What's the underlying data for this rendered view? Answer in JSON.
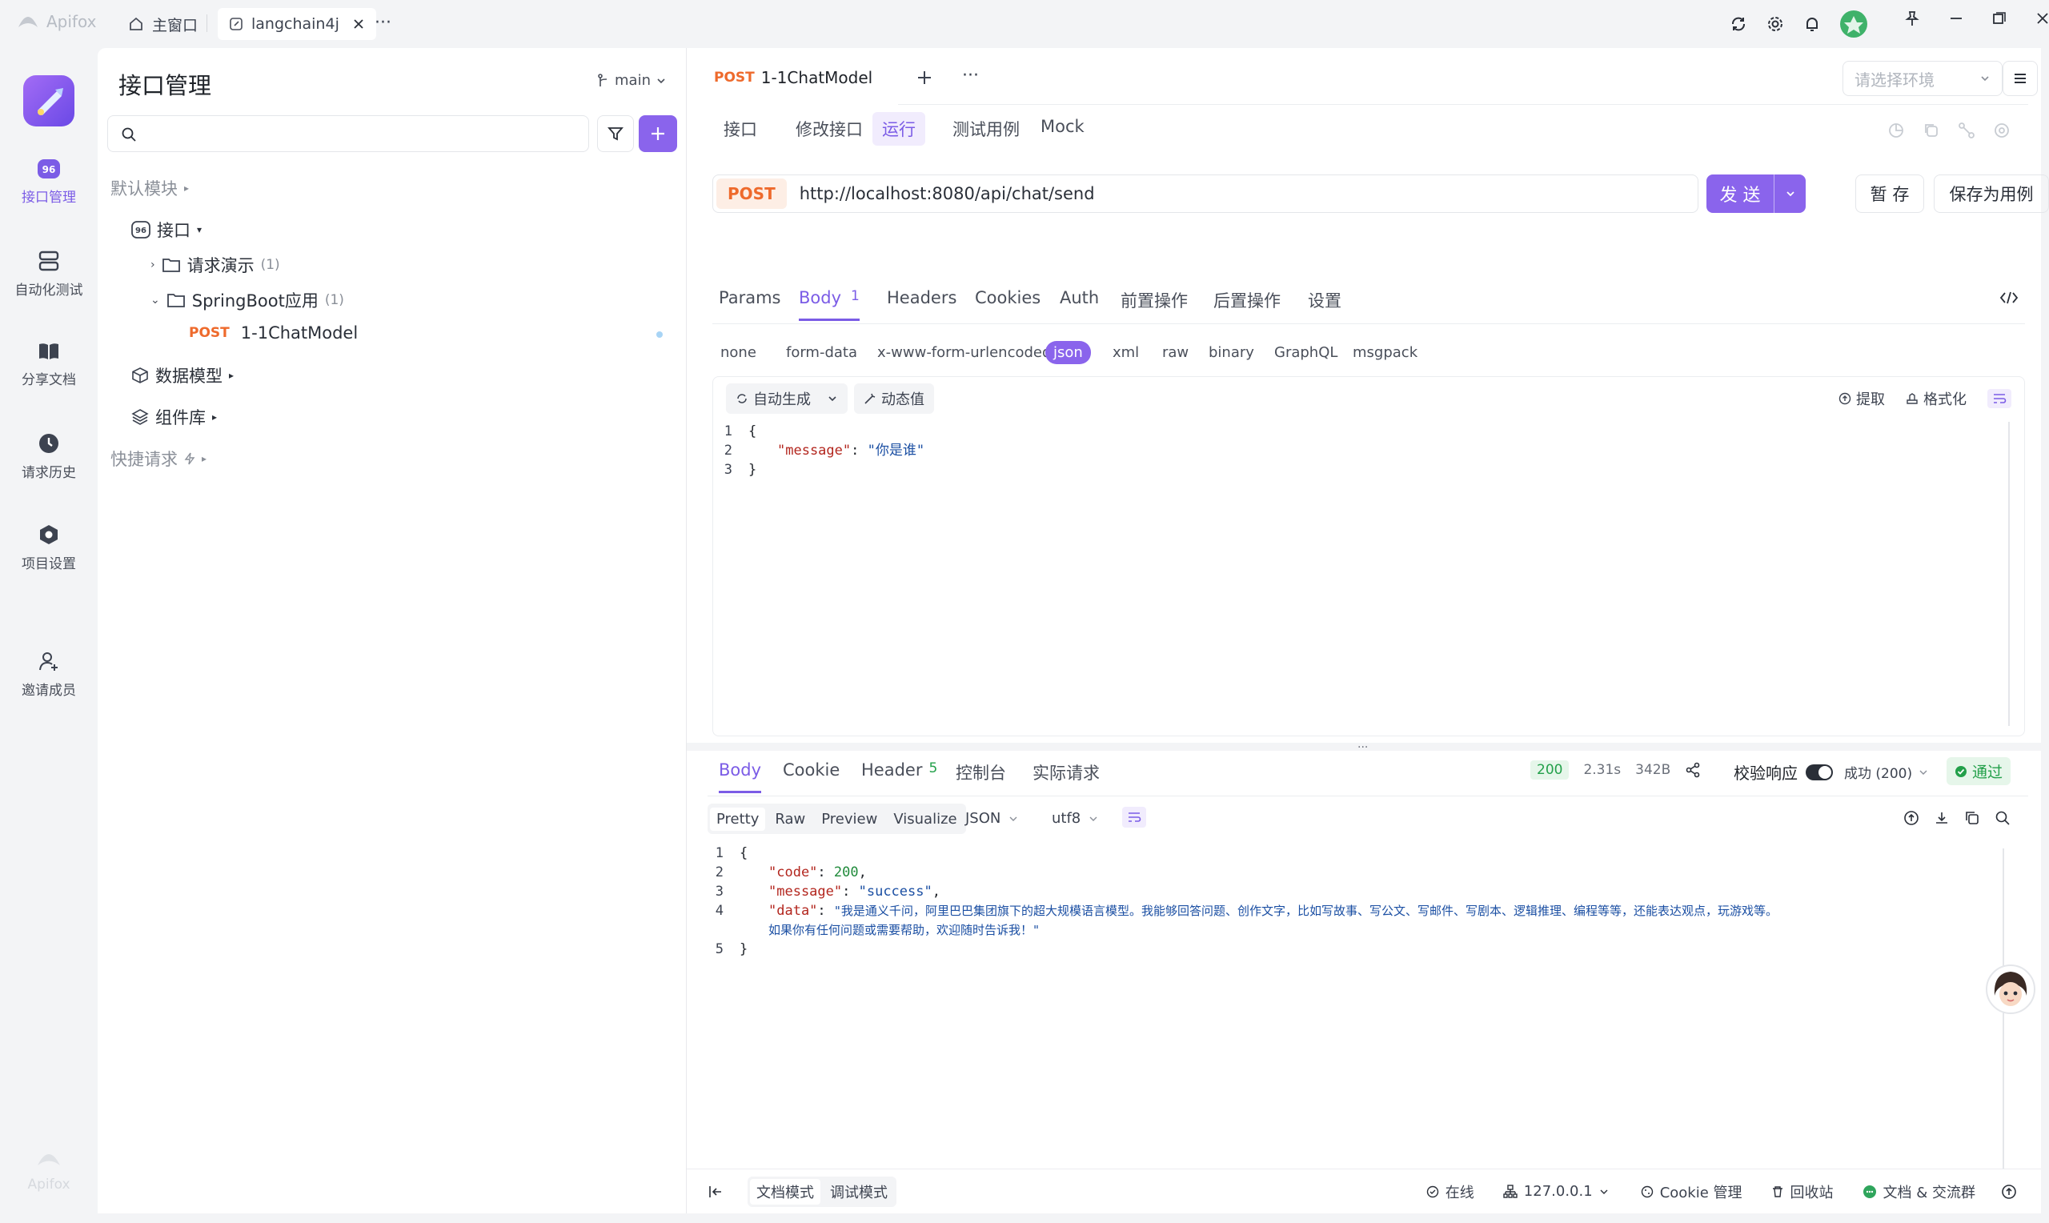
{
  "app": {
    "name": "Apifox"
  },
  "titlebar": {
    "tabs": [
      {
        "label": "主窗口",
        "icon": "home-icon"
      },
      {
        "label": "langchain4j",
        "icon": "link-icon"
      }
    ],
    "more": "···"
  },
  "rail": {
    "items": [
      {
        "label": "接口管理",
        "icon": "api-icon"
      },
      {
        "label": "自动化测试",
        "icon": "database-icon"
      },
      {
        "label": "分享文档",
        "icon": "book-icon"
      },
      {
        "label": "请求历史",
        "icon": "clock-icon"
      },
      {
        "label": "项目设置",
        "icon": "settings-icon"
      },
      {
        "label": "邀请成员",
        "icon": "add-user-icon"
      }
    ],
    "footer_logo": "Apifox"
  },
  "sidebar": {
    "title": "接口管理",
    "branch": "main",
    "search_placeholder": "",
    "tree": {
      "default_module": "默认模块",
      "api_root": "接口",
      "folder1": {
        "name": "请求演示",
        "count": "(1)"
      },
      "folder2": {
        "name": "SpringBoot应用",
        "count": "(1)"
      },
      "endpoint": {
        "method": "POST",
        "name": "1-1ChatModel"
      },
      "data_models": "数据模型",
      "components": "组件库",
      "quick_requests": "快捷请求"
    }
  },
  "main": {
    "tab": {
      "method": "POST",
      "name": "1-1ChatModel"
    },
    "env_placeholder": "请选择环境",
    "subtabs": [
      "接口",
      "修改接口",
      "运行",
      "测试用例",
      "Mock"
    ],
    "request": {
      "method": "POST",
      "url": "http://localhost:8080/api/chat/send",
      "send_label": "发 送",
      "save_label": "暂 存",
      "save_case_label": "保存为用例"
    },
    "param_tabs": [
      "Params",
      "Body",
      "Headers",
      "Cookies",
      "Auth",
      "前置操作",
      "后置操作",
      "设置"
    ],
    "body_count": "1",
    "body_types": [
      "none",
      "form-data",
      "x-www-form-urlencoded",
      "json",
      "xml",
      "raw",
      "binary",
      "GraphQL",
      "msgpack"
    ],
    "editor": {
      "auto_generate": "自动生成",
      "dynamic_value": "动态值",
      "extract": "提取",
      "format": "格式化",
      "lines": [
        {
          "n": "1",
          "open": "{"
        },
        {
          "n": "2",
          "key": "\"message\"",
          "value": "\"你是谁\""
        },
        {
          "n": "3",
          "close": "}"
        }
      ]
    },
    "response": {
      "tabs": [
        "Body",
        "Cookie",
        "Header",
        "控制台",
        "实际请求"
      ],
      "header_count": "5",
      "status": "200",
      "time": "2.31s",
      "size": "342B",
      "validate_label": "校验响应",
      "result": "成功 (200)",
      "pass_label": "通过",
      "views": [
        "Pretty",
        "Raw",
        "Preview",
        "Visualize"
      ],
      "format": "JSON",
      "encoding": "utf8",
      "lines": {
        "l1": "1",
        "l2": "2",
        "l3": "3",
        "l4": "4",
        "l5": "5",
        "code_key": "\"code\"",
        "code_val": "200",
        "message_key": "\"message\"",
        "message_val": "\"success\"",
        "data_key": "\"data\"",
        "data_val_1": "\"我是通义千问，阿里巴巴集团旗下的超大规模语言模型。我能够回答问题、创作文字，比如写故事、写公文、写邮件、写剧本、逻辑推理、编程等等，还能表达观点，玩游戏等。",
        "data_val_2": "如果你有任何问题或需要帮助，欢迎随时告诉我！\""
      }
    }
  },
  "bottom": {
    "doc_mode": "文档模式",
    "debug_mode": "调试模式",
    "online": "在线",
    "host": "127.0.0.1",
    "cookie": "Cookie 管理",
    "trash": "回收站",
    "community": "文档 & 交流群"
  }
}
